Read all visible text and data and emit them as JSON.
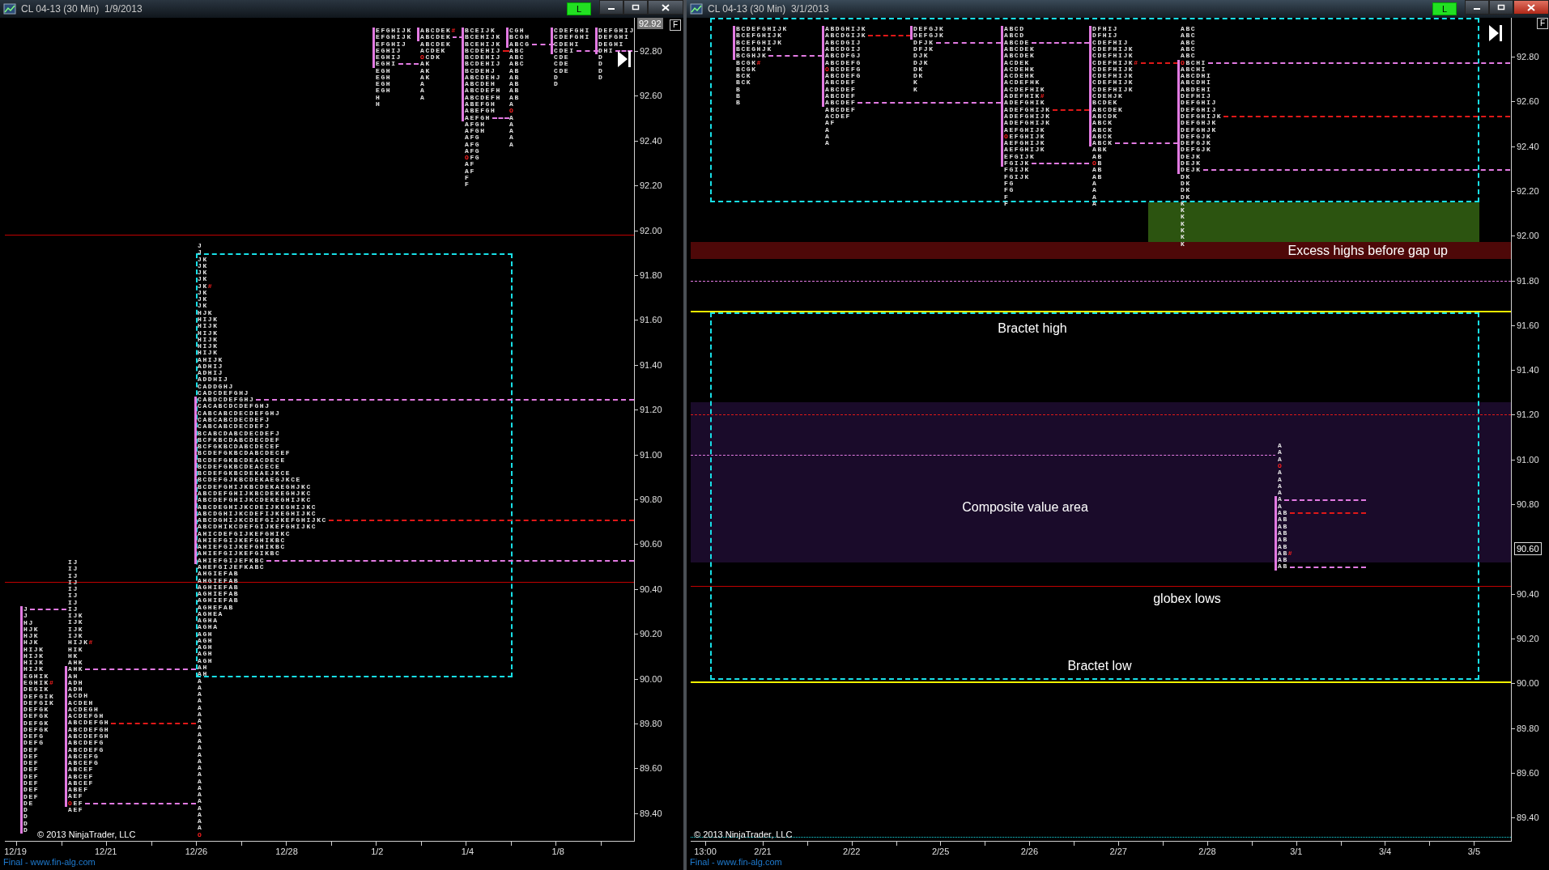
{
  "windows": [
    {
      "title": "CL 04-13 (30 Min)  1/9/2013",
      "active": false,
      "mode_button": "L",
      "corner_button": "F",
      "price_flag": "92.92",
      "y_axis": [
        {
          "label": "92.80",
          "kind": "tick"
        },
        {
          "label": "92.60",
          "kind": "tick"
        },
        {
          "label": "92.40",
          "kind": "tick"
        },
        {
          "label": "92.20",
          "kind": "tick"
        },
        {
          "label": "92.00",
          "kind": "tick"
        },
        {
          "label": "91.80",
          "kind": "tick"
        },
        {
          "label": "91.60",
          "kind": "tick"
        },
        {
          "label": "91.40",
          "kind": "tick"
        },
        {
          "label": "91.20",
          "kind": "tick"
        },
        {
          "label": "91.00",
          "kind": "tick"
        },
        {
          "label": "90.80",
          "kind": "tick"
        },
        {
          "label": "90.60",
          "kind": "tick"
        },
        {
          "label": "90.40",
          "kind": "tick"
        },
        {
          "label": "90.20",
          "kind": "tick"
        },
        {
          "label": "90.00",
          "kind": "tick"
        },
        {
          "label": "89.80",
          "kind": "tick"
        },
        {
          "label": "89.60",
          "kind": "tick"
        },
        {
          "label": "89.40",
          "kind": "tick"
        }
      ],
      "x_axis": [
        "12/19",
        "12/21",
        "12/26",
        "12/28",
        "1/2",
        "1/4",
        "1/8"
      ],
      "profiles": [
        {
          "rows": [
            "J",
            "J",
            "HJ",
            "HJK",
            "HJK",
            "HJK",
            "HIJK",
            "HIJK",
            "HIJK",
            "HIJK",
            "EGHIK",
            {
              "text": "EGHIK",
              "close_mark": "#"
            },
            "DEGIK",
            "DEFGIK",
            "DEFGIK",
            "DEFGK",
            "DEFGK",
            "DEFGK",
            "DEFGK",
            "DEFG",
            "DEFG",
            "DEF",
            "DEF",
            "DEF",
            "DEF",
            "DEF",
            "DEF",
            "DEF",
            "DEF",
            "DE",
            "D",
            "D",
            "D",
            "D"
          ]
        },
        {
          "rows": [
            "IJ",
            "IJ",
            "IJ",
            "IJ",
            "IJ",
            "IJ",
            "IJ",
            "IJ",
            "IJK",
            "IJK",
            "IJK",
            "IJK",
            {
              "text": "HIJK",
              "close_mark": "#"
            },
            "HIK",
            "HK",
            "AHK",
            "AHK",
            "AH",
            "ADH",
            "ADH",
            "ACDH",
            "ACDEH",
            "ACDEGH",
            "ACDEFGH",
            "ABCDEFGH",
            "ABCDEFGH",
            "ABCDEFGH",
            "ABCDEFG",
            "ABCDEFG",
            "ABCEFG",
            "ABCEFG",
            "ABCEF",
            "ABCEF",
            "ABCEF",
            "ABEF",
            "AEF",
            {
              "text": "OEF",
              "open": true
            },
            "AEF"
          ]
        },
        {
          "rows": [
            "J",
            "J",
            "JK",
            "JK",
            "JK",
            "JK",
            {
              "text": "JK",
              "close_mark": "#"
            },
            "JK",
            "JK",
            "JK",
            "HJK",
            "HIJK",
            "HIJK",
            "HIJK",
            "HIJK",
            "HIJK",
            "HIJK",
            "AHIJK",
            "ADHIJ",
            "ADHIJ",
            "ADDHIJ",
            "CADDGHJ",
            "CADCDEFGHJ",
            "CABDCDEFGHJ",
            "CACABCDCDEFGHJ",
            "CABCABCDECDEFGHJ",
            "CABCABCDECDEFJ",
            "CABCABCDECDEFJ",
            "BCABCDABCDECDEFJ",
            "BCFKBCDABCDECDEF",
            "BCFGKBCDABCDECEF",
            "BCDEFGKBCDABCDECEF",
            "BCDEFGKBCDEACDECE",
            "BCDEFGKBCDEACECE",
            "BCDEFGKBCDEKAEJKCE",
            "BCDEFGJKBCDEKAEGJKCE",
            "BCDEFGHIJKBCDEKAEGHJKC",
            "ABCDEFGHIJKBCDEKEGHJKC",
            "ABCDEFGHIJKCDEKEGHIJKC",
            "ABCDEGHIJKCDEIJKEGHIJKC",
            "ABCDGHIJKCDEFIJKEGHIJKC",
            "ABCDGHIJKCDEFGIJKEFGHIJKC",
            "ABCDHIKCDEFGIJKEFGHIJKC",
            "AHICDEFGIJKEFGHIKC",
            "AHIEFGIJKEFGHIKBC",
            "AHIEFGIJKEFGHIKBC",
            "AHIEFGIJKEFGIKBC",
            "AHIEFGIJEFKBC",
            "AHEFGIJEFKABC",
            "AHGIEFAB",
            "AHGIEFAB",
            "AGHIEFAB",
            "AGHIEFAB",
            "AGHIEFAB",
            "AGHEFAB",
            "AGHEA",
            "AGHA",
            "AGHA",
            "AGH",
            "AGH",
            "AGH",
            "AGH",
            "AGH",
            "AH",
            "AH",
            "A",
            "A",
            "A",
            "A",
            "A",
            "A",
            "A",
            "A",
            "A",
            "A",
            "A",
            "A",
            "A",
            "A",
            "A",
            "A",
            "A",
            "A",
            "A",
            "A",
            "A",
            "A",
            "A",
            {
              "text": "O",
              "open": true
            }
          ]
        },
        {
          "rows": [
            "EFGHIJK",
            "EFGHIJK",
            "EFGHIJ",
            "EGHIJ",
            "EGHIJ",
            "EGHI",
            "EGH",
            "EGH",
            "EGH",
            "EGH",
            "H",
            "H"
          ]
        },
        {
          "rows": [
            {
              "text": "ABCDEK",
              "close_mark": "#"
            },
            "ABCDEK",
            "ABCDEK",
            "ACDEK",
            {
              "text": "OCDK",
              "open": true
            },
            "AK",
            "AK",
            "AK",
            "A",
            "A",
            "A"
          ]
        },
        {
          "rows": [
            "BCEIJK",
            "BCEHIJK",
            "BCEHIJK",
            "BCDEHIJ",
            "BCDEHIJ",
            "BCDEHIJ",
            "BCDEHJ",
            "ABCDEHJ",
            "ABCDEH",
            "ABCDEFH",
            "ABCDEFH",
            "ABEFGH",
            "ABEFGH",
            "AEFGH",
            "AFGH",
            "AFGH",
            "AFG",
            "AFG",
            "AFG",
            {
              "text": "OFG",
              "open": true
            },
            "AF",
            "AF",
            "F",
            "F"
          ]
        },
        {
          "rows": [
            "CGH",
            "BCGH",
            "ABCG",
            "ABC",
            "ABC",
            "ABC",
            "AB",
            "AB",
            "AB",
            "AB",
            "AB",
            "A",
            {
              "text": "O",
              "open": true
            },
            "A",
            "A",
            "A",
            "A",
            "A"
          ]
        },
        {
          "rows": [
            "CDEFGHI",
            "CDEFGHI",
            "CDEHI",
            "CDEI",
            "CDE",
            "CDE",
            "CDE",
            "D",
            "D"
          ]
        },
        {
          "rows": [
            "DEFGHIJ",
            "DEFGHI",
            "DEGHI",
            "DHI",
            "D",
            "D",
            "D",
            "D"
          ]
        }
      ],
      "copyright": "© 2013 NinjaTrader, LLC",
      "footer": "Final - www.fin-alg.com"
    },
    {
      "title": "CL 04-13 (30 Min)  3/1/2013",
      "active": true,
      "mode_button": "L",
      "corner_button": "F",
      "y_axis": [
        {
          "label": "92.80",
          "kind": "tick"
        },
        {
          "label": "92.60",
          "kind": "tick"
        },
        {
          "label": "92.40",
          "kind": "tick"
        },
        {
          "label": "92.20",
          "kind": "tick"
        },
        {
          "label": "92.00",
          "kind": "tick"
        },
        {
          "label": "91.80",
          "kind": "tick"
        },
        {
          "label": "91.60",
          "kind": "tick"
        },
        {
          "label": "91.40",
          "kind": "tick"
        },
        {
          "label": "91.20",
          "kind": "tick"
        },
        {
          "label": "91.00",
          "kind": "tick"
        },
        {
          "label": "90.80",
          "kind": "tick"
        },
        {
          "label": "90.60",
          "kind": "flag"
        },
        {
          "label": "90.40",
          "kind": "tick"
        },
        {
          "label": "90.20",
          "kind": "tick"
        },
        {
          "label": "90.00",
          "kind": "tick"
        },
        {
          "label": "89.80",
          "kind": "tick"
        },
        {
          "label": "89.60",
          "kind": "tick"
        },
        {
          "label": "89.40",
          "kind": "tick"
        }
      ],
      "x_axis": [
        "13:00",
        "2/21",
        "2/22",
        "2/25",
        "2/26",
        "2/27",
        "2/28",
        "3/1",
        "3/4",
        "3/5"
      ],
      "profiles": [
        {
          "rows": [
            "BCDEFGHIJK",
            "BCEFGHIJK",
            "BCEFGHIJK",
            "BCEGHJK",
            "BCGHJK",
            {
              "text": "BCGK",
              "close_mark": "#"
            },
            "BCGK",
            "BCK",
            "BCK",
            "B",
            "B",
            "B"
          ]
        },
        {
          "rows": [
            "ABDGHIJK",
            "ABCDGIJK",
            "ABCDGIJ",
            "ABCDGIJ",
            "ABCDFGJ",
            "ABCDEFG",
            {
              "text": "OBCDEFG",
              "open": true
            },
            "ABCDEFG",
            "ABCDEF",
            "ABCDEF",
            "ABCDEF",
            "ABCDEF",
            "ABCDEF",
            "ACDEF",
            "AF",
            "A",
            "A",
            "A"
          ]
        },
        {
          "rows": [
            "DEFGJK",
            "DEFGJK",
            "DFJK",
            "DFJK",
            "DJK",
            "DJK",
            "DK",
            "DK",
            "K",
            "K"
          ]
        },
        {
          "rows": [
            "ABCD",
            "ABCD",
            "ABCDE",
            "ABCDEK",
            "ABCDEK",
            "ACDEK",
            "ACDEHK",
            "ACDEHK",
            "ACDEFHK",
            "ACDEFHIK",
            {
              "text": "ADEFHIK",
              "close_mark": "#"
            },
            "ADEFGHIK",
            "ADEFGHIJK",
            "ADEFGHIJK",
            "ADEFGHIJK",
            "AEFGHIJK",
            {
              "text": "OEFGHIJK",
              "open": true
            },
            "AEFGHIJK",
            "AEFGHIJK",
            "EFGIJK",
            "FGIJK",
            "FGIJK",
            "FGIJK",
            "FG",
            "FG",
            "F",
            "F"
          ]
        },
        {
          "rows": [
            "DFHIJ",
            "DFHIJ",
            "CDEFHIJ",
            "CDEFHIJK",
            "CDEFHIJK",
            {
              "text": "CDEFHIJK",
              "close_mark": "#"
            },
            "CDEFHIJK",
            "CDEFHIJK",
            "CDEFHIJK",
            "CDEFHIJK",
            "CDEHJK",
            "BCDEK",
            "ABCDEK",
            "ABCDK",
            "ABCK",
            "ABCK",
            "ABCK",
            "ABCK",
            "ABK",
            "AB",
            {
              "text": "OB",
              "open": true
            },
            "AB",
            "AB",
            "A",
            "A",
            "A",
            "A"
          ]
        },
        {
          "rows": [
            "ABC",
            "ABC",
            "ABC",
            "ABC",
            "ABC",
            {
              "text": "OBCHI",
              "open": true
            },
            "ABCHI",
            "ABCDHI",
            "ABCDHI",
            "ABDEHI",
            "DEFHIJ",
            "DEFGHIJ",
            "DEFGHIJ",
            "DEFGHIJK",
            "DEFGHJK",
            "DEFGHJK",
            "DEFGJK",
            "DEFGJK",
            "DEFGJK",
            "DEJK",
            "DEJK",
            "DEJK",
            "DK",
            "DK",
            "DK",
            "DK",
            "K",
            "K",
            "K",
            "K",
            "K",
            "K",
            "K"
          ]
        },
        {
          "rows": [
            "A",
            "A",
            "A",
            {
              "text": "O",
              "open": true
            },
            "A",
            "A",
            "A",
            "A",
            "A",
            "A",
            "AB",
            "AB",
            "AB",
            "AB",
            "AB",
            "AB",
            {
              "text": "AB",
              "close_mark": "#"
            },
            "AB",
            "AB"
          ]
        }
      ],
      "labels": [
        {
          "kind": "banner",
          "text": "Excess highs before gap up"
        },
        {
          "kind": "label",
          "text": "Bractet high"
        },
        {
          "kind": "label",
          "text": "Composite value area"
        },
        {
          "kind": "label",
          "text": "globex lows"
        },
        {
          "kind": "label",
          "text": "Bractet low"
        }
      ],
      "copyright": "© 2013 NinjaTrader, LLC",
      "footer": "Final - www.fin-alg.com"
    }
  ]
}
